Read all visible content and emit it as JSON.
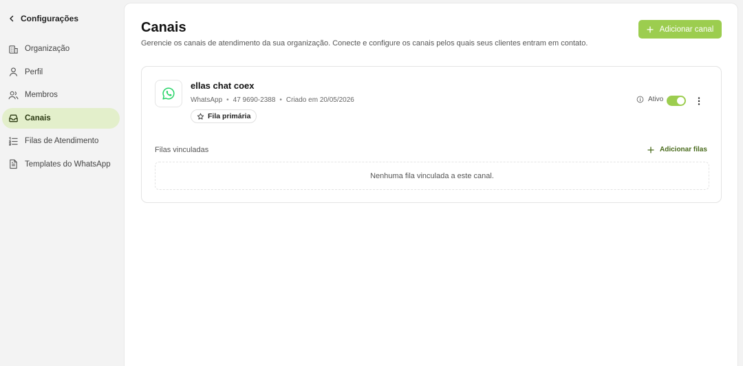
{
  "sidebar": {
    "back_label": "Configurações",
    "items": [
      {
        "label": "Organização",
        "icon": "building-icon",
        "active": false
      },
      {
        "label": "Perfil",
        "icon": "user-icon",
        "active": false
      },
      {
        "label": "Membros",
        "icon": "users-icon",
        "active": false
      },
      {
        "label": "Canais",
        "icon": "inbox-icon",
        "active": true
      },
      {
        "label": "Filas de Atendimento",
        "icon": "list-ordered-icon",
        "active": false
      },
      {
        "label": "Templates do WhatsApp",
        "icon": "file-text-icon",
        "active": false
      }
    ]
  },
  "main": {
    "title": "Canais",
    "subtitle": "Gerencie os canais de atendimento da sua organização. Conecte e configure os canais pelos quais seus clientes entram em contato.",
    "add_channel_label": "Adicionar canal",
    "channel": {
      "name": "ellas chat coex",
      "type": "WhatsApp",
      "phone": "47 9690-2388",
      "created": "Criado em 20/05/2026",
      "queue_badge": "Fila primária",
      "status_label": "Ativo",
      "active": true,
      "linked_title": "Filas vinculadas",
      "add_queues_label": "Adicionar filas",
      "empty_message": "Nenhuma fila vinculada a este canal."
    }
  },
  "colors": {
    "accent": "#9ccd4f",
    "active_nav_bg": "#e3efcb",
    "whatsapp": "#25d366"
  }
}
